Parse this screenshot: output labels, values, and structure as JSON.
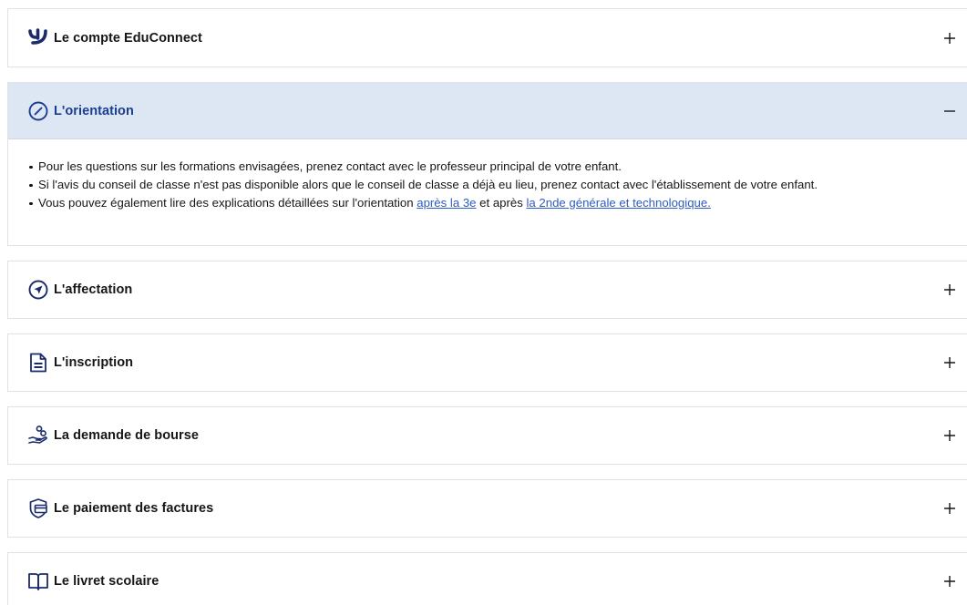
{
  "accordion": {
    "items": [
      {
        "title": "Le compte EduConnect",
        "icon": "educonnect-logo-icon",
        "expanded": false
      },
      {
        "title": "L'orientation",
        "icon": "compass-icon",
        "expanded": true,
        "content": {
          "bullet1": "Pour les questions sur les formations envisagées, prenez contact avec le professeur principal de votre enfant.",
          "bullet2": "Si l'avis du conseil de classe n'est pas disponible alors que le conseil de classe a déjà eu lieu, prenez contact avec l'établissement de votre enfant.",
          "bullet3_prefix": "Vous pouvez également lire des explications détaillées sur l'orientation ",
          "link1": "après la 3e",
          "bullet3_middle": " et après ",
          "link2": "la 2nde générale et technologique."
        }
      },
      {
        "title": "L'affectation",
        "icon": "navigation-arrow-icon",
        "expanded": false
      },
      {
        "title": "L'inscription",
        "icon": "document-icon",
        "expanded": false
      },
      {
        "title": "La demande de bourse",
        "icon": "hand-coins-icon",
        "expanded": false
      },
      {
        "title": "Le paiement des factures",
        "icon": "shield-card-icon",
        "expanded": false
      },
      {
        "title": "Le livret scolaire",
        "icon": "book-icon",
        "expanded": false
      }
    ]
  },
  "colors": {
    "expanded_bg": "#dde6f3",
    "expanded_title": "#1b3f8f",
    "link": "#2f5cc4",
    "border": "#e2e2e2"
  }
}
